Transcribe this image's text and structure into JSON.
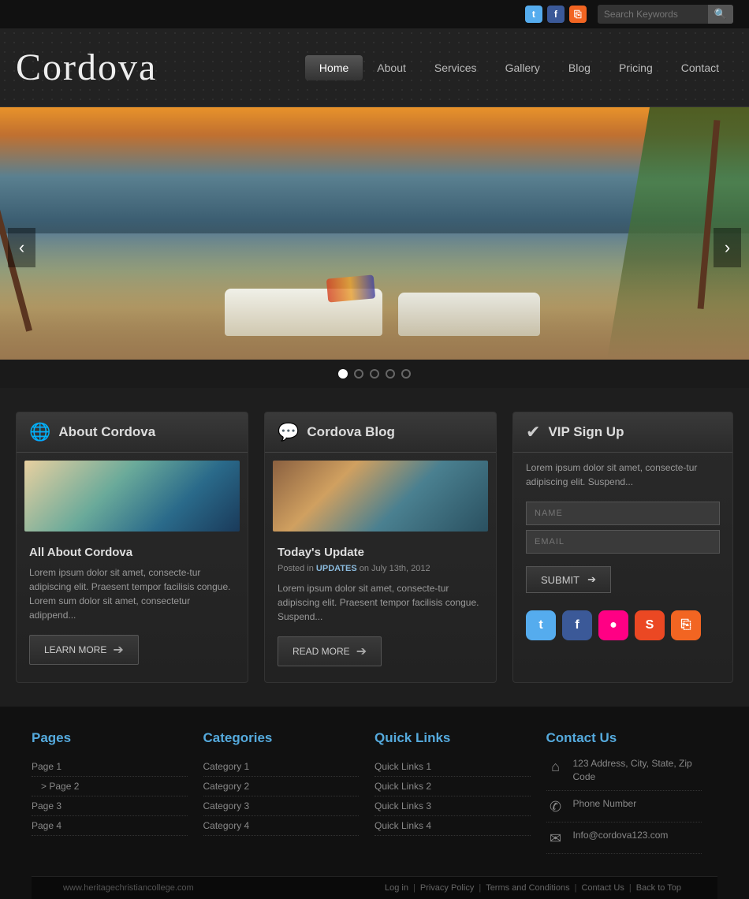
{
  "topbar": {
    "search_placeholder": "Search Keywords"
  },
  "header": {
    "logo": "Cordova",
    "nav": [
      {
        "label": "Home",
        "active": true
      },
      {
        "label": "About",
        "active": false
      },
      {
        "label": "Services",
        "active": false
      },
      {
        "label": "Gallery",
        "active": false
      },
      {
        "label": "Blog",
        "active": false
      },
      {
        "label": "Pricing",
        "active": false
      },
      {
        "label": "Contact",
        "active": false
      }
    ]
  },
  "slider": {
    "dots": [
      {
        "active": true
      },
      {
        "active": false
      },
      {
        "active": false
      },
      {
        "active": false
      },
      {
        "active": false
      }
    ],
    "prev_label": "‹",
    "next_label": "›"
  },
  "about_card": {
    "title": "About Cordova",
    "subtitle": "All About Cordova",
    "text": "Lorem ipsum dolor sit amet, consecte-tur adipiscing elit. Praesent tempor facilisis congue. Lorem sum dolor sit amet, consectetur adippend...",
    "btn_label": "LEARN MORE"
  },
  "blog_card": {
    "title": "Cordova Blog",
    "subtitle": "Today's Update",
    "meta_pre": "Posted in ",
    "meta_highlight": "UPDATES",
    "meta_post": " on July 13th, 2012",
    "text": "Lorem ipsum dolor sit amet, consecte-tur adipiscing elit. Praesent tempor facilisis congue. Suspend...",
    "btn_label": "READ MORE"
  },
  "vip_card": {
    "title": "VIP Sign Up",
    "desc": "Lorem ipsum dolor sit amet, consecte-tur adipiscing elit. Suspend...",
    "name_placeholder": "NAME",
    "email_placeholder": "EMAIL",
    "submit_label": "SUBMIT"
  },
  "footer": {
    "pages": {
      "title": "Pages",
      "items": [
        "Page 1",
        "> Page 2",
        "Page 3",
        "Page 4"
      ]
    },
    "categories": {
      "title": "Categories",
      "items": [
        "Category 1",
        "Category 2",
        "Category 3",
        "Category 4"
      ]
    },
    "quicklinks": {
      "title": "Quick Links",
      "items": [
        "Quick Links 1",
        "Quick Links 2",
        "Quick Links 3",
        "Quick Links 4"
      ]
    },
    "contact": {
      "title": "Contact Us",
      "address": "123 Address, City, State, Zip Code",
      "phone": "Phone Number",
      "email": "Info@cordova123.com"
    }
  },
  "footer_bottom": {
    "url": "www.heritagechristiancollege.com",
    "links": [
      "Log in",
      "Privacy Policy",
      "Terms and Conditions",
      "Contact Us",
      "Back to Top"
    ]
  }
}
